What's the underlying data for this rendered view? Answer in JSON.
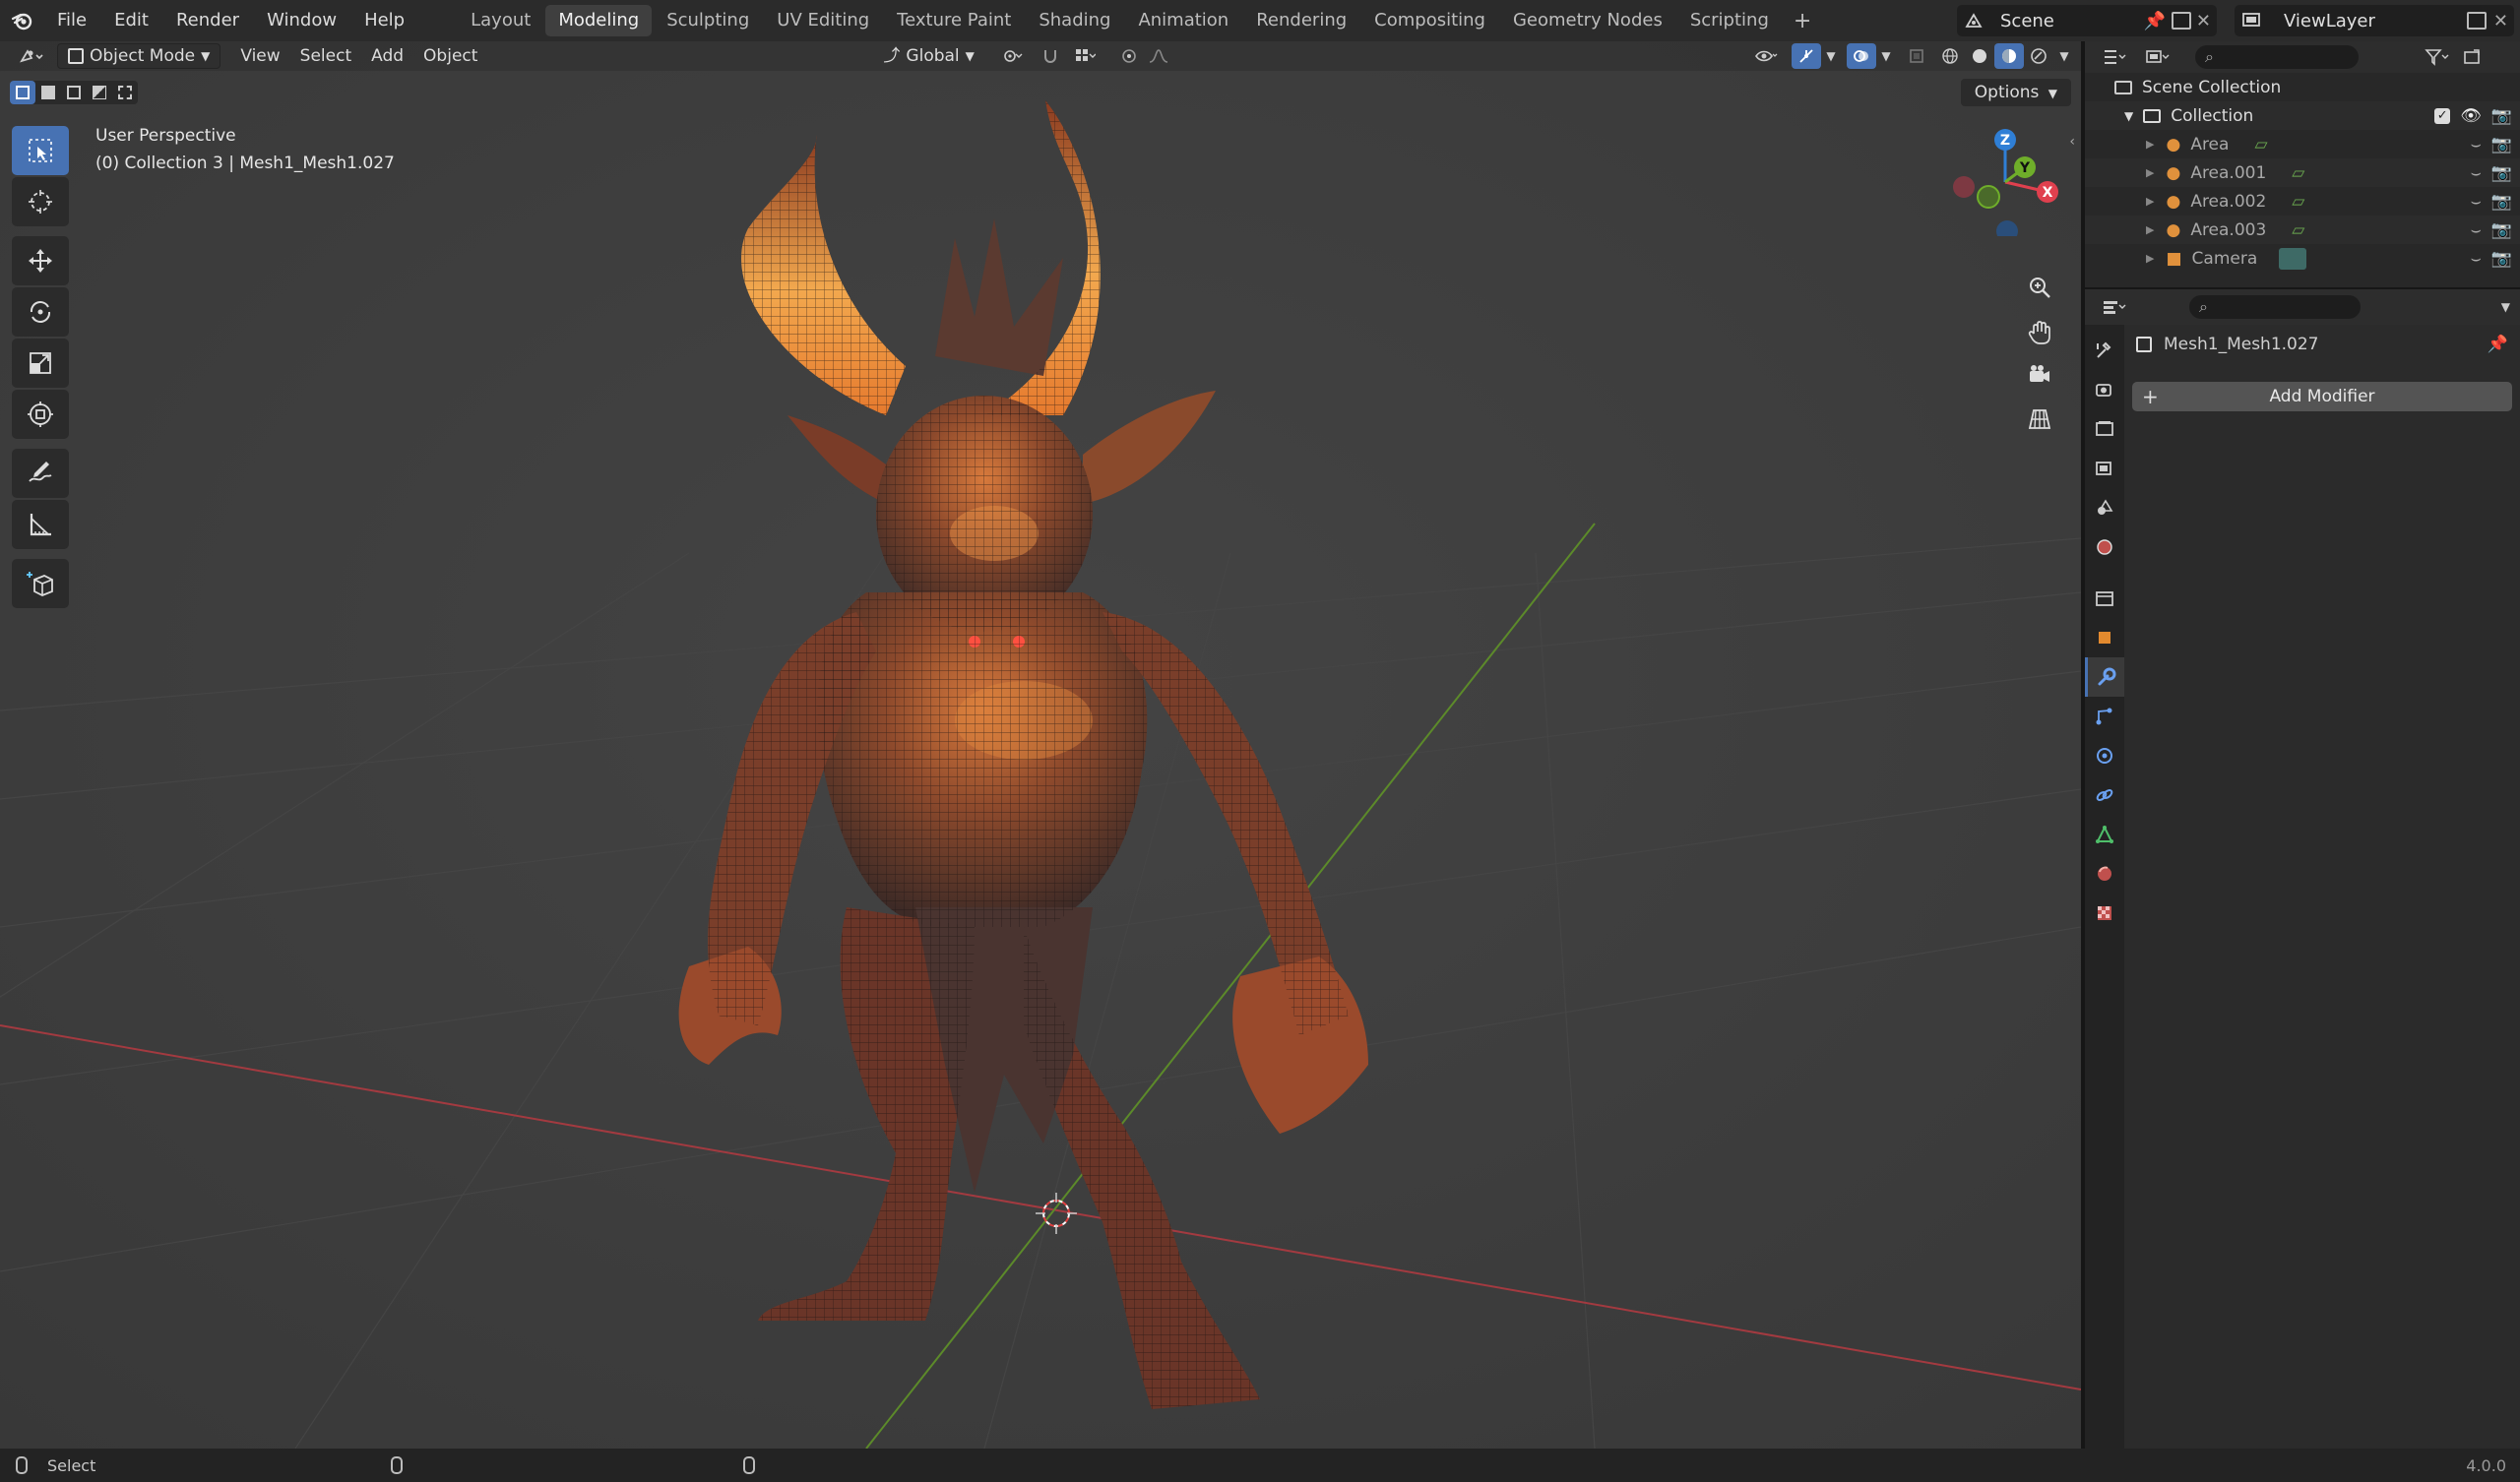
{
  "menu": {
    "items": [
      "File",
      "Edit",
      "Render",
      "Window",
      "Help"
    ]
  },
  "workspaces": {
    "tabs": [
      "Layout",
      "Modeling",
      "Sculpting",
      "UV Editing",
      "Texture Paint",
      "Shading",
      "Animation",
      "Rendering",
      "Compositing",
      "Geometry Nodes",
      "Scripting"
    ],
    "active": "Modeling"
  },
  "scene": {
    "name": "Scene"
  },
  "view_layer": {
    "name": "ViewLayer"
  },
  "viewport_header": {
    "mode": "Object Mode",
    "menus": [
      "View",
      "Select",
      "Add",
      "Object"
    ],
    "orientation": "Global"
  },
  "viewport": {
    "view_name": "User Perspective",
    "collection_info": "(0) Collection 3 | Mesh1_Mesh1.027",
    "options_label": "Options",
    "gizmo": {
      "z": "Z",
      "y": "Y",
      "x": "X"
    }
  },
  "outliner": {
    "root": "Scene Collection",
    "collection": "Collection",
    "items": [
      "Area",
      "Area.001",
      "Area.002",
      "Area.003",
      "Camera"
    ]
  },
  "properties": {
    "object_name": "Mesh1_Mesh1.027",
    "add_modifier_label": "Add Modifier"
  },
  "statusbar": {
    "left_label": "Select",
    "version": "4.0.0"
  },
  "colors": {
    "accent": "#4772b3",
    "x_axis": "#e0404e",
    "y_axis": "#6fae2a",
    "z_axis": "#2f7fd6",
    "viewport_bg": "#3d3d3d"
  }
}
